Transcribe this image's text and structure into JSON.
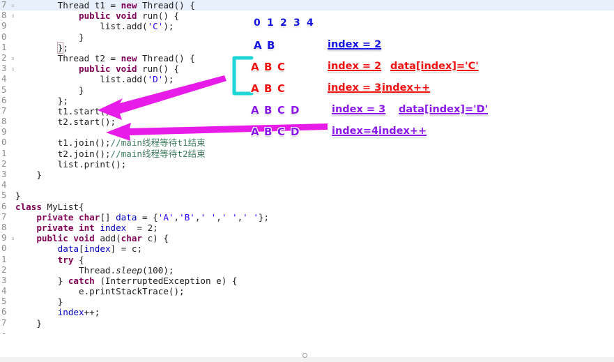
{
  "editor": {
    "current_line_highlighted": true,
    "colors": {
      "keyword": "#7f0055",
      "string": "#2a00ff",
      "comment": "#3f7f5f",
      "field": "#0000c0",
      "plain": "#202020",
      "current_line_bg": "#e8f0fb"
    },
    "lines": [
      {
        "num": "7",
        "fold": "▫",
        "current": true,
        "html": "        <span class='pln'>Thread t1 = </span><span class='kw'>new</span><span class='pln'> Thread() {</span>"
      },
      {
        "num": "8",
        "fold": "▫",
        "current": false,
        "html": "            <span class='kw'>public void</span><span class='pln'> run() {</span>"
      },
      {
        "num": "9",
        "fold": "",
        "current": false,
        "html": "                <span class='pln'>list.add(</span><span class='str'>'C'</span><span class='pln'>);</span>"
      },
      {
        "num": "0",
        "fold": "",
        "current": false,
        "html": "            <span class='pln'>}</span>"
      },
      {
        "num": "1",
        "fold": "",
        "current": false,
        "html": "        <span class='brk'>}</span><span class='pln'>;</span>"
      },
      {
        "num": "2",
        "fold": "▫",
        "current": false,
        "html": "        <span class='pln'>Thread t2 = </span><span class='kw'>new</span><span class='pln'> Thread() {</span>"
      },
      {
        "num": "3",
        "fold": "▫",
        "current": false,
        "html": "            <span class='kw'>public void</span><span class='pln'> run() {</span>"
      },
      {
        "num": "4",
        "fold": "",
        "current": false,
        "html": "                <span class='pln'>list.add(</span><span class='str'>'D'</span><span class='pln'>);</span>"
      },
      {
        "num": "5",
        "fold": "",
        "current": false,
        "html": "            <span class='pln'>}</span>"
      },
      {
        "num": "6",
        "fold": "",
        "current": false,
        "html": "        <span class='pln'>};</span>"
      },
      {
        "num": "7",
        "fold": "",
        "current": false,
        "html": "        <span class='pln'>t1.start();</span>"
      },
      {
        "num": "8",
        "fold": "",
        "current": false,
        "html": "        <span class='pln'>t2.start();</span>"
      },
      {
        "num": "9",
        "fold": "",
        "current": false,
        "html": ""
      },
      {
        "num": "0",
        "fold": "",
        "current": false,
        "html": "        <span class='pln'>t1.join();</span><span class='cmt'>//main线程等待t1结束</span>"
      },
      {
        "num": "1",
        "fold": "",
        "current": false,
        "html": "        <span class='pln'>t2.join();</span><span class='cmt'>//main线程等待t2结束</span>"
      },
      {
        "num": "2",
        "fold": "",
        "current": false,
        "html": "        <span class='pln'>list.print();</span>"
      },
      {
        "num": "3",
        "fold": "",
        "current": false,
        "html": "    <span class='pln'>}</span>"
      },
      {
        "num": "4",
        "fold": "",
        "current": false,
        "html": ""
      },
      {
        "num": "5",
        "fold": "",
        "current": false,
        "html": "<span class='pln'>}</span>"
      },
      {
        "num": "6",
        "fold": "",
        "current": false,
        "html": "<span class='kw'>class</span><span class='pln'> MyList{</span>"
      },
      {
        "num": "7",
        "fold": "",
        "current": false,
        "html": "    <span class='kw'>private char</span><span class='pln'>[] </span><span class='fld'>data</span><span class='pln'> = {</span><span class='str'>'A'</span><span class='pln'>,</span><span class='str'>'B'</span><span class='pln'>,</span><span class='str'>' '</span><span class='pln'>,</span><span class='str'>' '</span><span class='pln'>,</span><span class='str'>' '</span><span class='pln'>};</span>"
      },
      {
        "num": "8",
        "fold": "",
        "current": false,
        "html": "    <span class='kw'>private int</span><span class='pln'> </span><span class='fld'>index</span><span class='pln'>  = 2;</span>"
      },
      {
        "num": "9",
        "fold": "▫",
        "current": false,
        "html": "    <span class='kw'>public void</span><span class='pln'> add(</span><span class='kw'>char</span><span class='pln'> c) {</span>"
      },
      {
        "num": "0",
        "fold": "",
        "current": false,
        "html": "        <span class='fld'>data</span><span class='pln'>[</span><span class='fld'>index</span><span class='pln'>] = c;</span>"
      },
      {
        "num": "1",
        "fold": "",
        "current": false,
        "html": "        <span class='kw'>try</span><span class='pln'> {</span>"
      },
      {
        "num": "2",
        "fold": "",
        "current": false,
        "html": "            <span class='pln'>Thread.</span><span class='ital pln'>sleep</span><span class='pln'>(100);</span>"
      },
      {
        "num": "3",
        "fold": "",
        "current": false,
        "html": "        <span class='pln'>} </span><span class='kw'>catch</span><span class='pln'> (InterruptedException e) {</span>"
      },
      {
        "num": "4",
        "fold": "",
        "current": false,
        "html": "            <span class='pln'>e.printStackTrace();</span>"
      },
      {
        "num": "5",
        "fold": "",
        "current": false,
        "html": "        <span class='pln'>}</span>"
      },
      {
        "num": "6",
        "fold": "",
        "current": false,
        "html": "        <span class='fld'>index</span><span class='pln'>++;</span>"
      },
      {
        "num": "7",
        "fold": "",
        "current": false,
        "html": "    <span class='pln'>}</span>"
      },
      {
        "num": "-",
        "fold": "",
        "current": false,
        "html": ""
      }
    ]
  },
  "annotations": {
    "index_header": {
      "cells": [
        "0",
        "1",
        "2",
        "3",
        "4"
      ],
      "color": "#1414e0"
    },
    "rows": [
      {
        "id": "row-ab",
        "color": "#1414e0",
        "cells": [
          "A",
          "B"
        ],
        "index_label": "index = 2",
        "op_label": ""
      },
      {
        "id": "row-abc-1",
        "color": "#f01010",
        "cells": [
          "A",
          "B",
          "C"
        ],
        "index_label": "index = 2",
        "op_label": "data[index]='C'"
      },
      {
        "id": "row-abc-2",
        "color": "#f01010",
        "cells": [
          "A",
          "B",
          "C"
        ],
        "index_label": "index = 3",
        "op_label": "index++"
      },
      {
        "id": "row-abcd-1",
        "color": "#8a18e8",
        "cells": [
          "A",
          "B",
          "C",
          "D"
        ],
        "index_label": "index = 3",
        "op_label": "data[index]='D'"
      },
      {
        "id": "row-abcd-2",
        "color": "#8a18e8",
        "cells": [
          "A",
          "B",
          "C",
          "D"
        ],
        "index_label": "index=4",
        "op_label": "index++"
      }
    ],
    "shapes": {
      "bracket": {
        "name": "cyan-bracket",
        "color": "#1ed6d6"
      },
      "arrow_one": {
        "name": "magenta-arrow-to-t1-start",
        "color": "#e81ce8"
      },
      "arrow_two": {
        "name": "magenta-arrow-to-t2-start",
        "color": "#e81ce8"
      }
    }
  }
}
